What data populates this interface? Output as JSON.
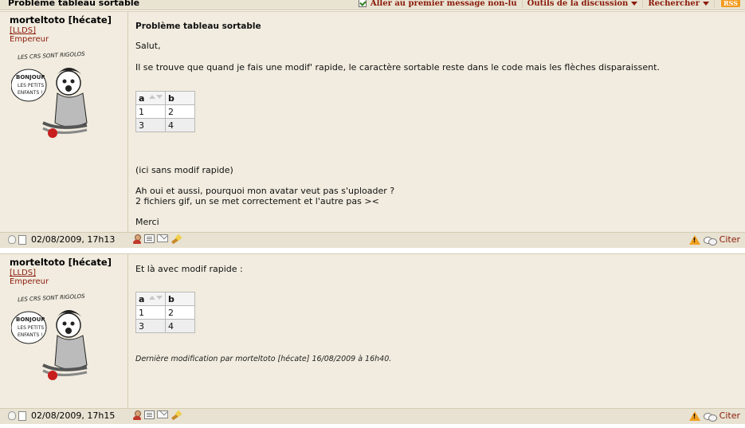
{
  "topbar": {
    "title": "Problème tableau sortable",
    "unread_link": "Aller au premier message non-lu",
    "tools_menu": "Outils de la discussion",
    "search_menu": "Rechercher",
    "rss": "RSS"
  },
  "posts": [
    {
      "author": "morteltoto [hécate]",
      "group": "[LLDS]",
      "rank": "Empereur",
      "subject": "Problème tableau sortable",
      "greeting": "Salut,",
      "body1": "Il se trouve que quand je fais une modif' rapide, le caractère sortable reste dans le code mais les flèches disparaissent.",
      "table": {
        "headers": [
          "a",
          "b"
        ],
        "rows": [
          [
            "1",
            "2"
          ],
          [
            "3",
            "4"
          ]
        ]
      },
      "body2": "(ici sans modif rapide)",
      "body3": "Ah oui et aussi, pourquoi mon avatar veut pas s'uploader ?",
      "body4": "2 fichiers gif, un se met correctement et l'autre pas ><",
      "body5": "Merci",
      "date": "02/08/2009, 17h13",
      "quote": "Citer"
    },
    {
      "author": "morteltoto [hécate]",
      "group": "[LLDS]",
      "rank": "Empereur",
      "body1": "Et là avec modif rapide :",
      "table": {
        "headers": [
          "a",
          "b"
        ],
        "rows": [
          [
            "1",
            "2"
          ],
          [
            "3",
            "4"
          ]
        ]
      },
      "edit_note": "Dernière modification par morteltoto [hécate] 16/08/2009 à 16h40.",
      "date": "02/08/2009, 17h15",
      "quote": "Citer"
    }
  ],
  "avatar_text": {
    "caption": "LES CRS SONT RIGOLOS",
    "bubble_line1": "BONJOUR",
    "bubble_line2": "LES PETITS",
    "bubble_line3": "ENFANTS !"
  },
  "colors": {
    "accent": "#8b1a0a",
    "post_bg": "#f1ecdf",
    "footer_bg": "#e8e2d2"
  }
}
